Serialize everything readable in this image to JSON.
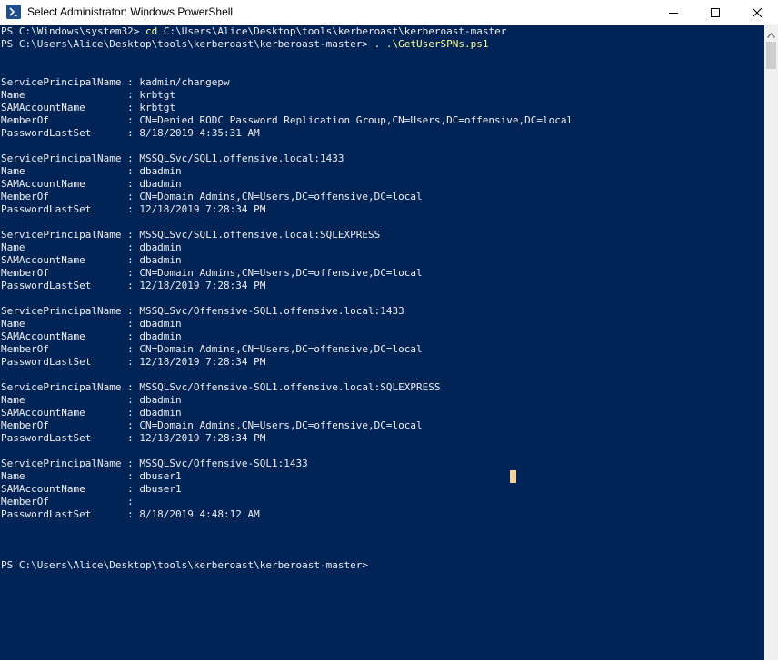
{
  "window": {
    "title": "Select Administrator: Windows PowerShell"
  },
  "console": {
    "prompt1": "PS C:\\Windows\\system32> ",
    "cmd1": "cd",
    "arg1": " C:\\Users\\Alice\\Desktop\\tools\\kerberoast\\kerberoast-master",
    "prompt2": "PS C:\\Users\\Alice\\Desktop\\tools\\kerberoast\\kerberoast-master> ",
    "cmd2": ". .\\GetUserSPNs.ps1",
    "records": [
      {
        "spn": "ServicePrincipalName : kadmin/changepw",
        "name": "Name                 : krbtgt",
        "sam": "SAMAccountName       : krbtgt",
        "member": "MemberOf             : CN=Denied RODC Password Replication Group,CN=Users,DC=offensive,DC=local",
        "pwd": "PasswordLastSet      : 8/18/2019 4:35:31 AM"
      },
      {
        "spn": "ServicePrincipalName : MSSQLSvc/SQL1.offensive.local:1433",
        "name": "Name                 : dbadmin",
        "sam": "SAMAccountName       : dbadmin",
        "member": "MemberOf             : CN=Domain Admins,CN=Users,DC=offensive,DC=local",
        "pwd": "PasswordLastSet      : 12/18/2019 7:28:34 PM"
      },
      {
        "spn": "ServicePrincipalName : MSSQLSvc/SQL1.offensive.local:SQLEXPRESS",
        "name": "Name                 : dbadmin",
        "sam": "SAMAccountName       : dbadmin",
        "member": "MemberOf             : CN=Domain Admins,CN=Users,DC=offensive,DC=local",
        "pwd": "PasswordLastSet      : 12/18/2019 7:28:34 PM"
      },
      {
        "spn": "ServicePrincipalName : MSSQLSvc/Offensive-SQL1.offensive.local:1433",
        "name": "Name                 : dbadmin",
        "sam": "SAMAccountName       : dbadmin",
        "member": "MemberOf             : CN=Domain Admins,CN=Users,DC=offensive,DC=local",
        "pwd": "PasswordLastSet      : 12/18/2019 7:28:34 PM"
      },
      {
        "spn": "ServicePrincipalName : MSSQLSvc/Offensive-SQL1.offensive.local:SQLEXPRESS",
        "name": "Name                 : dbadmin",
        "sam": "SAMAccountName       : dbadmin",
        "member": "MemberOf             : CN=Domain Admins,CN=Users,DC=offensive,DC=local",
        "pwd": "PasswordLastSet      : 12/18/2019 7:28:34 PM"
      },
      {
        "spn": "ServicePrincipalName : MSSQLSvc/Offensive-SQL1:1433",
        "name": "Name                 : dbuser1",
        "sam": "SAMAccountName       : dbuser1",
        "member": "MemberOf             :",
        "pwd": "PasswordLastSet      : 8/18/2019 4:48:12 AM"
      }
    ],
    "prompt3": "PS C:\\Users\\Alice\\Desktop\\tools\\kerberoast\\kerberoast-master>"
  },
  "colors": {
    "background": "#012456",
    "text": "#eeedf0",
    "command": "#fffd99",
    "cursor": "#f5d29f"
  },
  "icons": {
    "app": "powershell-icon",
    "minimize": "minimize-icon",
    "maximize": "maximize-icon",
    "close": "close-icon",
    "scroll_up": "scroll-up-arrow-icon"
  }
}
